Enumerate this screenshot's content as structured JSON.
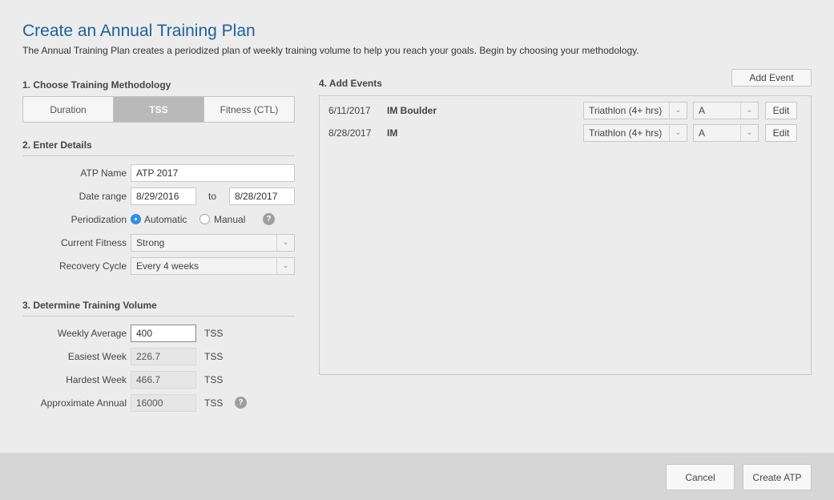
{
  "header": {
    "title": "Create an Annual Training Plan",
    "subtitle": "The Annual Training Plan creates a periodized plan of weekly training volume to help you reach your goals. Begin by choosing your methodology."
  },
  "methodology": {
    "section_title": "1. Choose Training Methodology",
    "options": [
      "Duration",
      "TSS",
      "Fitness (CTL)"
    ],
    "selected": "TSS"
  },
  "details": {
    "section_title": "2. Enter Details",
    "atp_name_label": "ATP Name",
    "atp_name_value": "ATP 2017",
    "date_range_label": "Date range",
    "date_start": "8/29/2016",
    "date_to_label": "to",
    "date_end": "8/28/2017",
    "periodization_label": "Periodization",
    "periodization_automatic": "Automatic",
    "periodization_manual": "Manual",
    "periodization_selected": "Automatic",
    "current_fitness_label": "Current Fitness",
    "current_fitness_value": "Strong",
    "recovery_cycle_label": "Recovery Cycle",
    "recovery_cycle_value": "Every 4 weeks"
  },
  "volume": {
    "section_title": "3. Determine Training Volume",
    "weekly_average_label": "Weekly Average",
    "weekly_average_value": "400",
    "easiest_week_label": "Easiest Week",
    "easiest_week_value": "226.7",
    "hardest_week_label": "Hardest Week",
    "hardest_week_value": "466.7",
    "approx_annual_label": "Approximate Annual",
    "approx_annual_value": "16000",
    "unit": "TSS"
  },
  "events": {
    "section_title": "4. Add Events",
    "add_event_label": "Add Event",
    "edit_label": "Edit",
    "items": [
      {
        "date": "6/11/2017",
        "name": "IM Boulder",
        "type": "Triathlon (4+ hrs)",
        "priority": "A"
      },
      {
        "date": "8/28/2017",
        "name": "IM",
        "type": "Triathlon (4+ hrs)",
        "priority": "A"
      }
    ]
  },
  "footer": {
    "cancel_label": "Cancel",
    "create_label": "Create ATP"
  },
  "icons": {
    "help": "question-circle-icon",
    "dropdown": "chevron-down-icon"
  },
  "colors": {
    "title": "#1f5f9f",
    "radio_selected": "#2f8fe6",
    "segment_active": "#b9b9b9"
  }
}
